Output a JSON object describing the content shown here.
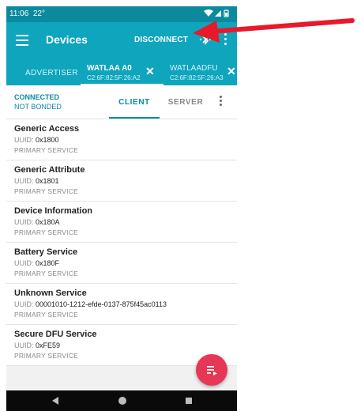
{
  "status_bar": {
    "time": "11:06",
    "temperature": "22°"
  },
  "app_bar": {
    "title": "Devices",
    "disconnect_label": "DISCONNECT"
  },
  "device_tabs": [
    {
      "name": "ADVERTISER"
    },
    {
      "name": "WATLAA A0",
      "mac": "C2:6F:82:5F:26:A2"
    },
    {
      "name": "WATLAADFU",
      "mac": "C2:6F:82:5F:26:A3"
    }
  ],
  "connection": {
    "state": "CONNECTED",
    "bond": "NOT BONDED"
  },
  "sub_tabs": {
    "client": "CLIENT",
    "server": "SERVER"
  },
  "uuid_label": "UUID:",
  "services": [
    {
      "name": "Generic Access",
      "uuid": "0x1800",
      "type": "PRIMARY SERVICE"
    },
    {
      "name": "Generic Attribute",
      "uuid": "0x1801",
      "type": "PRIMARY SERVICE"
    },
    {
      "name": "Device Information",
      "uuid": "0x180A",
      "type": "PRIMARY SERVICE"
    },
    {
      "name": "Battery Service",
      "uuid": "0x180F",
      "type": "PRIMARY SERVICE"
    },
    {
      "name": "Unknown Service",
      "uuid": "00001010-1212-efde-0137-875f45ac0113",
      "type": "PRIMARY SERVICE"
    },
    {
      "name": "Secure DFU Service",
      "uuid": "0xFE59",
      "type": "PRIMARY SERVICE"
    }
  ],
  "colors": {
    "primary": "#0ea5bd",
    "primary_dark": "#0b8a9e",
    "fab": "#e63757",
    "annotation_arrow": "#e8192c"
  }
}
